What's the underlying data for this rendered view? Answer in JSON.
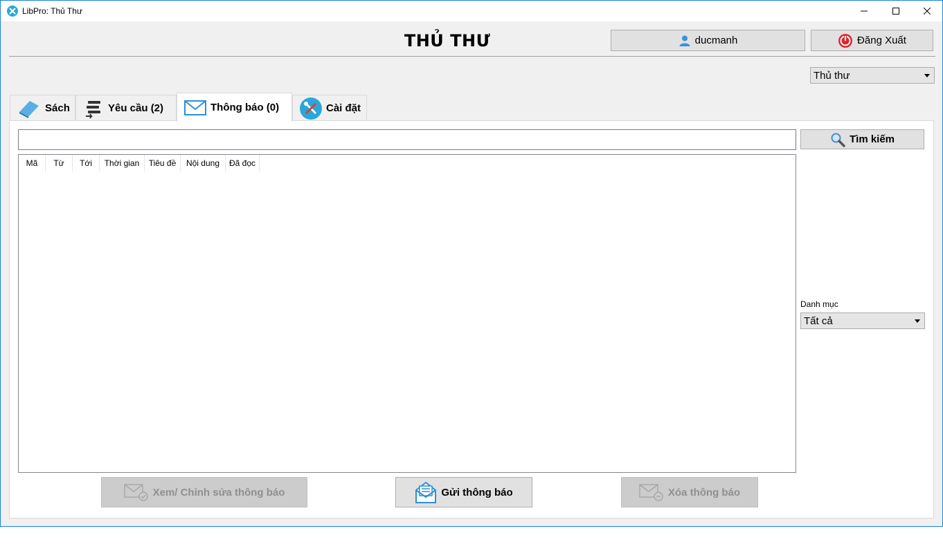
{
  "window": {
    "title": "LibPro: Thủ Thư"
  },
  "header": {
    "title": "THỦ THƯ",
    "user_label": "ducmanh",
    "logout_label": "Đăng Xuất",
    "role_select": "Thủ thư"
  },
  "tabs": [
    {
      "label": "Sách",
      "icon": "book-icon"
    },
    {
      "label": "Yêu cầu (2)",
      "icon": "requests-icon"
    },
    {
      "label": "Thông báo (0)",
      "icon": "envelope-icon",
      "active": true
    },
    {
      "label": "Cài đặt",
      "icon": "settings-icon"
    }
  ],
  "search": {
    "value": "",
    "button_label": "Tìm kiếm"
  },
  "table": {
    "columns": [
      "Mã",
      "Từ",
      "Tới",
      "Thời gian",
      "Tiêu đề",
      "Nội dung",
      "Đã đọc"
    ],
    "rows": []
  },
  "filter": {
    "label": "Danh mục",
    "value": "Tất cả"
  },
  "actions": {
    "view_edit_label": "Xem/ Chỉnh sửa thông báo",
    "send_label": "Gửi thông báo",
    "delete_label": "Xóa thông báo"
  },
  "colors": {
    "accent": "#1883d7",
    "logout_red": "#d9282f",
    "icon_blue": "#2b8fd6"
  }
}
